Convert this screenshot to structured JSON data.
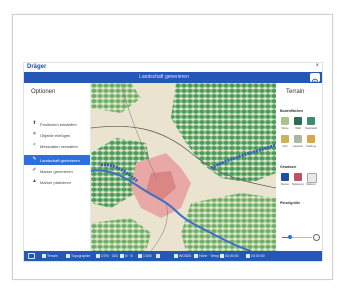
{
  "app": {
    "brand": "Dräger",
    "window_close": "×",
    "ribbon_title": "Landschaft generieren"
  },
  "sidebar": {
    "title": "Optionen",
    "items": [
      {
        "label": "Positionen einstellen",
        "icon": "pin-icon",
        "glyph": "⬆",
        "active": false
      },
      {
        "label": "Objekte einfügen",
        "icon": "close-icon",
        "glyph": "✕",
        "active": false
      },
      {
        "label": "Messdaten verwalten",
        "icon": "share-icon",
        "glyph": "<",
        "active": false
      },
      {
        "label": "Landschaft generieren",
        "icon": "brush-icon",
        "glyph": "✎",
        "active": true
      },
      {
        "label": "Marker generieren",
        "icon": "pen-icon",
        "glyph": "✐",
        "active": false
      },
      {
        "label": "Marker platzieren",
        "icon": "marker-icon",
        "glyph": "▲",
        "active": false
      }
    ]
  },
  "rightpanel": {
    "title": "Terrain",
    "section_ground": "Bodenflächen",
    "ground_swatches": [
      {
        "label": "Wiese",
        "color": "#a9c48a"
      },
      {
        "label": "Wald",
        "color": "#2f6b52"
      },
      {
        "label": "Nadelwald",
        "color": "#3f8a70"
      },
      {
        "label": "Feld",
        "color": "#c9b35a"
      },
      {
        "label": "Gewerbe",
        "color": "#a7b8a4"
      },
      {
        "label": "Siedlung",
        "color": "#d8a64c"
      }
    ],
    "section_water": "Gewässer",
    "water_swatches": [
      {
        "label": "Wasser",
        "color": "#1f4fa0"
      },
      {
        "label": "Bebauung",
        "color": "#c0506a"
      },
      {
        "label": "Radierer",
        "color": "#e9e9e9"
      }
    ],
    "section_brush": "Pinselgröße",
    "brush_size": 0.25
  },
  "statusbar": {
    "items": [
      "Terrain",
      "Topographie",
      "UTM · 32U",
      "N · E",
      "1:500",
      "",
      "WGS84",
      "Höhe · Temp",
      "00:00:00",
      "00:00:00"
    ]
  },
  "colors": {
    "accent": "#2f6fdc",
    "bar": "#2557b8"
  }
}
